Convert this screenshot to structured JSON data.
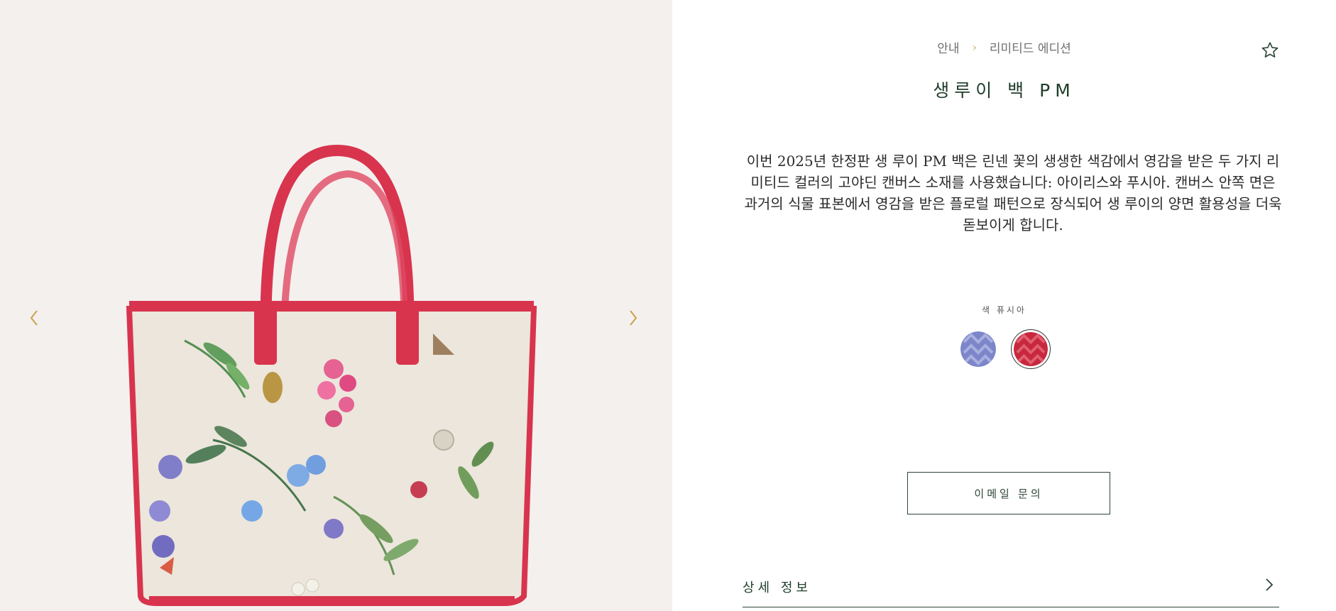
{
  "gallery": {
    "prev_icon": "chevron-left-icon",
    "next_icon": "chevron-right-icon",
    "image_alt": "생루이 백 PM"
  },
  "breadcrumb": {
    "items": [
      "안내",
      "리미티드 에디션"
    ],
    "separator": "›"
  },
  "favorite_icon": "star-outline-icon",
  "product": {
    "title": "생루이 백 PM",
    "description": "이번 2025년 한정판 생 루이 PM 백은 린넨 꽃의 생생한 색감에서 영감을 받은 두 가지 리미티드 컬러의 고야딘 캔버스 소재를 사용했습니다: 아이리스와 푸시아. 캔버스 안쪽 면은 과거의 식물 표본에서 영감을 받은 플로럴 패턴으로 장식되어 생 루이의 양면 활용성을 더욱 돋보이게 합니다."
  },
  "color": {
    "label": "색 퓨시아",
    "swatches": [
      {
        "name": "iris",
        "color": "#7d86c9",
        "selected": false
      },
      {
        "name": "fuchsia",
        "color": "#c8283e",
        "selected": true
      }
    ]
  },
  "actions": {
    "email_inquiry": "이메일 문의"
  },
  "details": {
    "label": "상세 정보",
    "icon": "chevron-right-icon"
  },
  "colors": {
    "accent_green": "#1f3d2b",
    "gallery_bg": "#f4f0ee",
    "breadcrumb_sep": "#c9a86a"
  }
}
